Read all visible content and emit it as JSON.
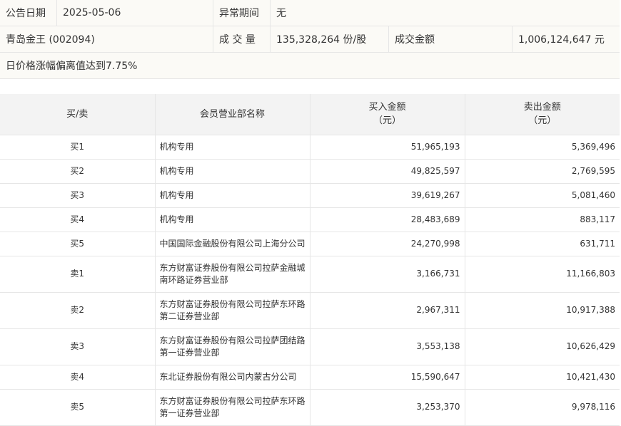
{
  "info": {
    "date_label": "公告日期",
    "date_value": "2025-05-06",
    "abnormal_label": "异常期间",
    "abnormal_value": "无",
    "stock_name": "青岛金王 (002094)",
    "volume_label": "成 交 量",
    "volume_value": "135,328,264 份/股",
    "amount_label": "成交金额",
    "amount_value": "1,006,124,647 元",
    "reason": "日价格涨幅偏离值达到7.75%"
  },
  "table": {
    "headers": {
      "side": "买/卖",
      "member": "会员营业部名称",
      "buy_line1": "买入金额",
      "buy_line2": "（元）",
      "sell_line1": "卖出金额",
      "sell_line2": "（元）"
    },
    "rows": [
      {
        "side": "买1",
        "member_line1": "机构专用",
        "member_line2": "",
        "buy": "51,965,193",
        "sell": "5,369,496"
      },
      {
        "side": "买2",
        "member_line1": "机构专用",
        "member_line2": "",
        "buy": "49,825,597",
        "sell": "2,769,595"
      },
      {
        "side": "买3",
        "member_line1": "机构专用",
        "member_line2": "",
        "buy": "39,619,267",
        "sell": "5,081,460"
      },
      {
        "side": "买4",
        "member_line1": "机构专用",
        "member_line2": "",
        "buy": "28,483,689",
        "sell": "883,117"
      },
      {
        "side": "买5",
        "member_line1": "中国国际金融股份有限公司上海分公司",
        "member_line2": "",
        "buy": "24,270,998",
        "sell": "631,711"
      },
      {
        "side": "卖1",
        "member_line1": "东方财富证券股份有限公司拉萨金融城",
        "member_line2": "南环路证券营业部",
        "buy": "3,166,731",
        "sell": "11,166,803"
      },
      {
        "side": "卖2",
        "member_line1": "东方财富证券股份有限公司拉萨东环路",
        "member_line2": "第二证券营业部",
        "buy": "2,967,311",
        "sell": "10,917,388"
      },
      {
        "side": "卖3",
        "member_line1": "东方财富证券股份有限公司拉萨团结路",
        "member_line2": "第一证券营业部",
        "buy": "3,553,138",
        "sell": "10,626,429"
      },
      {
        "side": "卖4",
        "member_line1": "东北证券股份有限公司内蒙古分公司",
        "member_line2": "",
        "buy": "15,590,647",
        "sell": "10,421,430"
      },
      {
        "side": "卖5",
        "member_line1": "东方财富证券股份有限公司拉萨东环路",
        "member_line2": "第一证券营业部",
        "buy": "3,253,370",
        "sell": "9,978,116"
      }
    ]
  }
}
